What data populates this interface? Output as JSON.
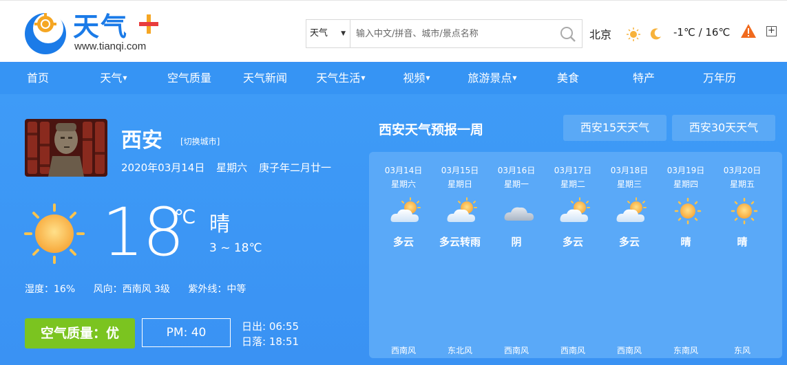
{
  "header": {
    "logo_text": "天气",
    "logo_url": "www.tianqi.com",
    "search_type": "天气",
    "search_placeholder": "输入中文/拼音、城市/景点名称",
    "current_city": "北京",
    "current_temp": "-1℃ / 16℃"
  },
  "nav": {
    "items": [
      {
        "label": "首页",
        "dropdown": false
      },
      {
        "label": "天气",
        "dropdown": true
      },
      {
        "label": "空气质量",
        "dropdown": false
      },
      {
        "label": "天气新闻",
        "dropdown": false
      },
      {
        "label": "天气生活",
        "dropdown": true
      },
      {
        "label": "视频",
        "dropdown": true
      },
      {
        "label": "旅游景点",
        "dropdown": true
      },
      {
        "label": "美食",
        "dropdown": false
      },
      {
        "label": "特产",
        "dropdown": false
      },
      {
        "label": "万年历",
        "dropdown": false
      }
    ]
  },
  "today": {
    "city": "西安",
    "switch_label": "[切换城市]",
    "date": "2020年03月14日",
    "weekday": "星期六",
    "lunar": "庚子年二月廿一",
    "temp": "18",
    "unit": "℃",
    "condition": "晴",
    "range": "3 ~ 18℃",
    "humidity": "湿度：16%",
    "wind": "风向：西南风 3级",
    "uv": "紫外线：中等",
    "aqi": "空气质量：优",
    "pm": "PM: 40",
    "sunrise": "日出: 06:55",
    "sunset": "日落: 18:51"
  },
  "forecast": {
    "title": "西安天气预报一周",
    "btn15": "西安15天天气",
    "btn30": "西安30天天气",
    "days": [
      {
        "date": "03月14日",
        "week": "星期六",
        "cond": "多云",
        "icon": "partly-cloudy-icon",
        "wind": "西南风"
      },
      {
        "date": "03月15日",
        "week": "星期日",
        "cond": "多云转雨",
        "icon": "partly-cloudy-icon",
        "wind": "东北风"
      },
      {
        "date": "03月16日",
        "week": "星期一",
        "cond": "阴",
        "icon": "overcast-icon",
        "wind": "西南风"
      },
      {
        "date": "03月17日",
        "week": "星期二",
        "cond": "多云",
        "icon": "partly-cloudy-icon",
        "wind": "西南风"
      },
      {
        "date": "03月18日",
        "week": "星期三",
        "cond": "多云",
        "icon": "partly-cloudy-icon",
        "wind": "西南风"
      },
      {
        "date": "03月19日",
        "week": "星期四",
        "cond": "晴",
        "icon": "sun-icon",
        "wind": "东南风"
      },
      {
        "date": "03月20日",
        "week": "星期五",
        "cond": "晴",
        "icon": "sun-icon",
        "wind": "东风"
      }
    ]
  },
  "colors": {
    "primary_blue": "#3b91f5",
    "nav_blue": "#3694f4",
    "logo_blue": "#1b7be8",
    "aqi_green": "#7bc420",
    "warning_orange": "#f06a1e"
  }
}
